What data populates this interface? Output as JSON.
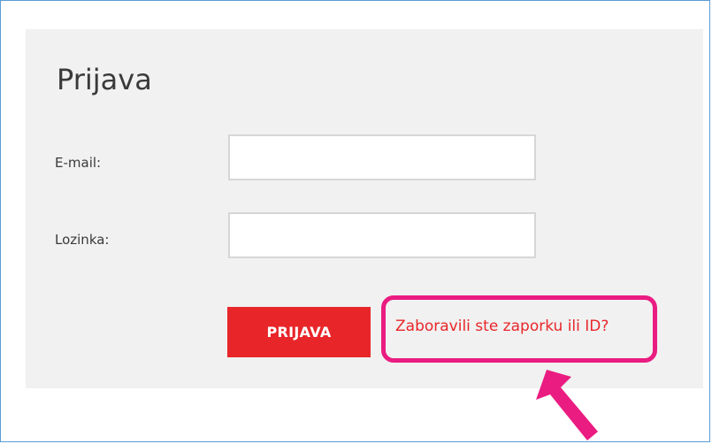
{
  "form": {
    "title": "Prijava",
    "email_label": "E-mail:",
    "email_value": "",
    "password_label": "Lozinka:",
    "password_value": "",
    "submit_label": "PRIJAVA",
    "forgot_link_label": "Zaboravili ste zaporku ili ID?"
  },
  "annotation": {
    "highlight_color": "#ea1c81",
    "icon": "arrow-pointer-icon"
  },
  "colors": {
    "accent": "#e8262a",
    "panel_bg": "#f1f1f1",
    "frame_border": "#5b9bd5"
  }
}
